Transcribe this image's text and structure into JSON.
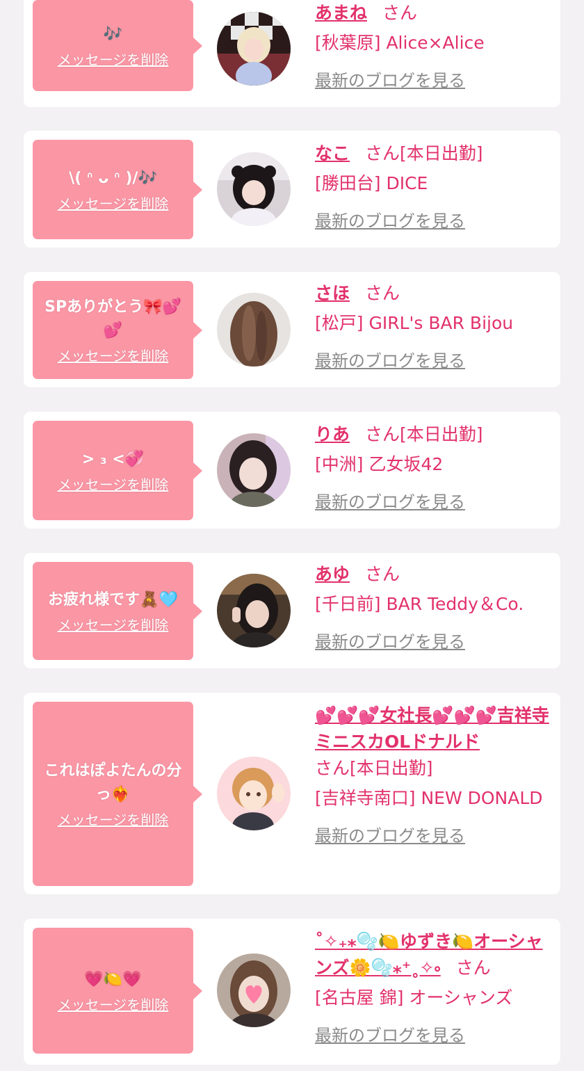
{
  "delete_label": "メッセージを削除",
  "blog_label": "最新のブログを見る",
  "san_label": "さん",
  "colors": {
    "bubble": "#fb96a5",
    "name": "#e2316b",
    "link_gray": "#8a8a8a",
    "card": "#ffffff"
  },
  "entries": [
    {
      "message": "🎶",
      "name": "あまね",
      "today": "",
      "shop": "[秋葉原] Alice×Alice",
      "avatar": "blonde-cosplay-girl-photo"
    },
    {
      "message": "\\( ᐢ ᴗ ᐢ )/🎶",
      "name": "なこ",
      "today": "[本日出勤]",
      "shop": "[勝田台] DICE",
      "avatar": "twin-tail-girl-photo"
    },
    {
      "message": "SPありがとう🎀💕💕",
      "name": "さほ",
      "today": "",
      "shop": "[松戸] GIRL's BAR Bijou",
      "avatar": "brown-hair-back-photo"
    },
    {
      "message": "> ₃ <💞",
      "name": "りあ",
      "today": "[本日出勤]",
      "shop": "[中洲] 乙女坂42",
      "avatar": "dark-hair-girl-photo"
    },
    {
      "message": "お疲れ様です🧸🩵",
      "name": "あゆ",
      "today": "",
      "shop": "[千日前] BAR Teddy＆Co.",
      "avatar": "peace-sign-girl-photo"
    },
    {
      "message": "これはぽよたんの分っ❤️‍🔥",
      "name": "💕💕💕女社長💕💕💕吉祥寺ミニスカOLドナルド",
      "today": "[本日出勤]",
      "shop": "[吉祥寺南口] NEW DONALD",
      "avatar": "anime-girl-illustration"
    },
    {
      "message": "💗🍋💗",
      "name": "˚✧₊⁎🫧🍋ゆずき🍋オーシャンズ🌼🫧⁎⁺˳✧༚",
      "today": "",
      "shop": "[名古屋 錦] オーシャンズ",
      "avatar": "girl-with-heart-sticker-photo"
    }
  ]
}
